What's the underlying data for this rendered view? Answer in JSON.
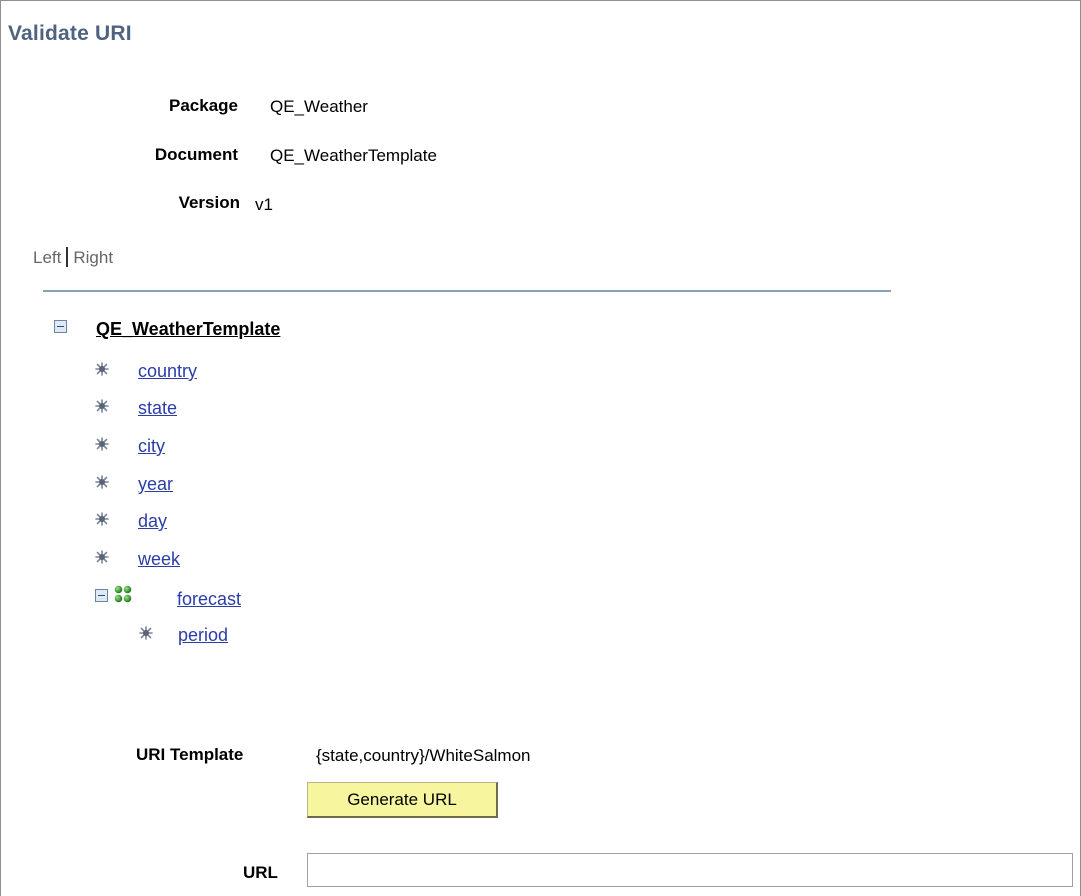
{
  "page": {
    "title": "Validate URI"
  },
  "info": {
    "package_label": "Package",
    "package_value": "QE_Weather",
    "document_label": "Document",
    "document_value": "QE_WeatherTemplate",
    "version_label": "Version",
    "version_value": "v1"
  },
  "panes": {
    "left_label": "Left",
    "right_label": "Right"
  },
  "tree": {
    "root_label": "QE_WeatherTemplate",
    "items": [
      {
        "label": "country",
        "icon": "primitive-element-icon"
      },
      {
        "label": "state",
        "icon": "primitive-element-icon"
      },
      {
        "label": "city",
        "icon": "primitive-element-icon"
      },
      {
        "label": "year",
        "icon": "primitive-element-icon"
      },
      {
        "label": "day",
        "icon": "primitive-element-icon"
      },
      {
        "label": "week",
        "icon": "primitive-element-icon"
      }
    ],
    "group": {
      "label": "forecast",
      "icon": "collection-icon",
      "children": [
        {
          "label": "period",
          "icon": "primitive-element-icon"
        }
      ]
    }
  },
  "uri": {
    "template_label": "URI Template",
    "template_value": "{state,country}/WhiteSalmon",
    "generate_button": "Generate URL",
    "url_label": "URL",
    "url_value": ""
  },
  "colors": {
    "title": "#4f6381",
    "link": "#2a3da8",
    "button_bg": "#f8f59f",
    "rule": "#8aa0b8"
  }
}
